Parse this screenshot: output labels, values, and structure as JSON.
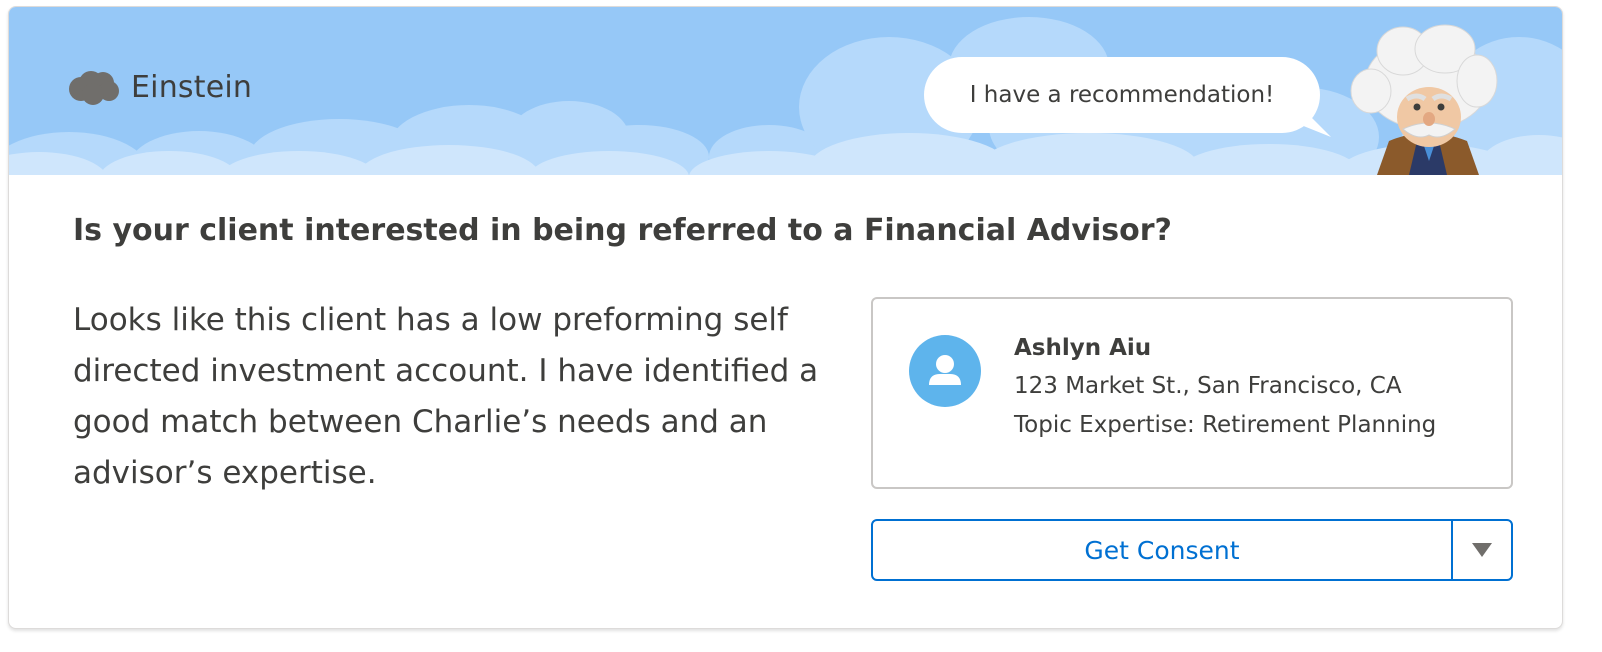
{
  "header": {
    "brand_title": "Einstein",
    "brand_icon": "salesforce-cloud-icon",
    "bubble_text": "I have a recommendation!",
    "mascot": "einstein-mascot"
  },
  "recommendation": {
    "question": "Is your client interested in being referred to a Financial Advisor?",
    "description": "Looks like this client has a low preforming self directed investment account. I have identified a good match between Charlie’s needs and an advisor’s expertise."
  },
  "contact": {
    "avatar_icon": "user-icon",
    "name": "Ashlyn Aiu",
    "address": "123 Market St., San Francisco, CA",
    "expertise": "Topic Expertise: Retirement Planning"
  },
  "actions": {
    "primary_label": "Get Consent",
    "menu_icon": "chevron-down-icon"
  },
  "colors": {
    "header_sky": "#96c8f7",
    "accent": "#0070d2",
    "avatar": "#5eb4ec",
    "text": "#3e3e3c"
  }
}
